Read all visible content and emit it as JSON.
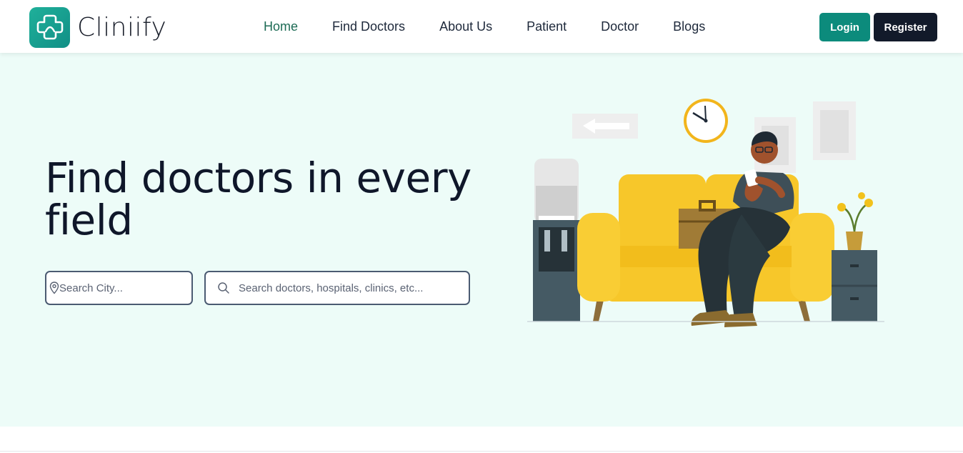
{
  "brand": {
    "name": "Cliniify",
    "logo_icon": "medical-cross-icon",
    "accent": "#1fb09a"
  },
  "nav": {
    "items": [
      {
        "label": "Home",
        "active": true
      },
      {
        "label": "Find Doctors",
        "active": false
      },
      {
        "label": "About Us",
        "active": false
      },
      {
        "label": "Patient",
        "active": false
      },
      {
        "label": "Doctor",
        "active": false
      },
      {
        "label": "Blogs",
        "active": false
      }
    ]
  },
  "auth": {
    "login_label": "Login",
    "register_label": "Register",
    "login_color": "#0c8b7c",
    "register_color": "#121a2a"
  },
  "hero": {
    "title": "Find doctors in every field",
    "background": "#edfcf8",
    "city_input": {
      "placeholder": "Search City...",
      "value": "",
      "icon": "map-pin-icon"
    },
    "search_input": {
      "placeholder": "Search doctors, hospitals, clinics, etc...",
      "value": "",
      "icon": "search-icon"
    },
    "illustration": "man-on-yellow-sofa-waiting-room-illustration"
  }
}
